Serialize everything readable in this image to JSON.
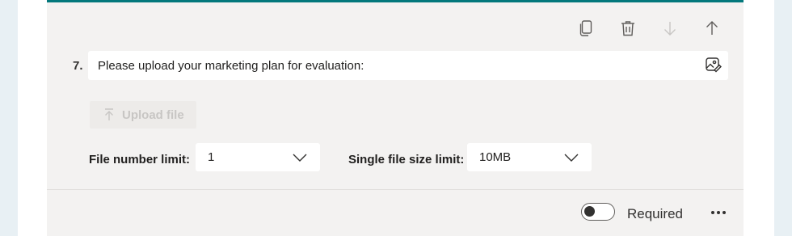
{
  "toolbar": {
    "icons": [
      "copy-icon",
      "delete-icon",
      "move-down-icon",
      "move-up-icon"
    ]
  },
  "question": {
    "number": "7.",
    "text": "Please upload your marketing plan for evaluation:",
    "image_icon": "insert-image-icon"
  },
  "upload": {
    "label": "Upload file",
    "icon": "upload-arrow-icon",
    "state": "disabled"
  },
  "limits": {
    "file_number_label": "File number limit:",
    "file_number_value": "1",
    "file_size_label": "Single file size limit:",
    "file_size_value": "10MB"
  },
  "footer": {
    "required_label": "Required",
    "required_on": false,
    "more_icon": "more-options-icon"
  },
  "colors": {
    "accent": "#03787c",
    "card_bg": "#f3f2f1",
    "side_bg": "#e8f0f4"
  }
}
